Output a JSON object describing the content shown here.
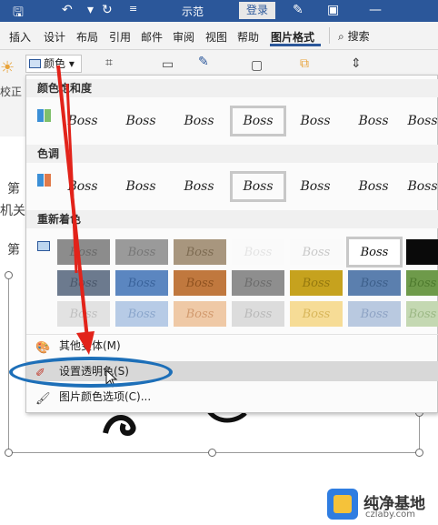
{
  "titlebar": {
    "doc_title": "示范",
    "login_label": "登录",
    "color": "#2b579a"
  },
  "ribbon_tabs": [
    "插入",
    "设计",
    "布局",
    "引用",
    "邮件",
    "审阅",
    "视图",
    "帮助",
    "图片格式"
  ],
  "active_tab": "图片格式",
  "search_label": "搜索",
  "ribbon": {
    "color_button_label": "颜色",
    "correct_label": "校正"
  },
  "side_text": [
    "第",
    "机关",
    "第"
  ],
  "menu": {
    "sections": {
      "saturation": "颜色饱和度",
      "tone": "色调",
      "recolor": "重新着色"
    },
    "thumb_text": "Boss",
    "items": {
      "more_variants": "其他变体(M)",
      "set_transparent": "设置透明色(S)",
      "picture_color_options": "图片颜色选项(C)..."
    }
  },
  "watermark": {
    "title": "纯净基地",
    "subtitle": "czlaby.com"
  },
  "colors": {
    "arrow": "#e2231a",
    "ellipse": "#1d6fb8",
    "hover": "#d8d8d8"
  }
}
